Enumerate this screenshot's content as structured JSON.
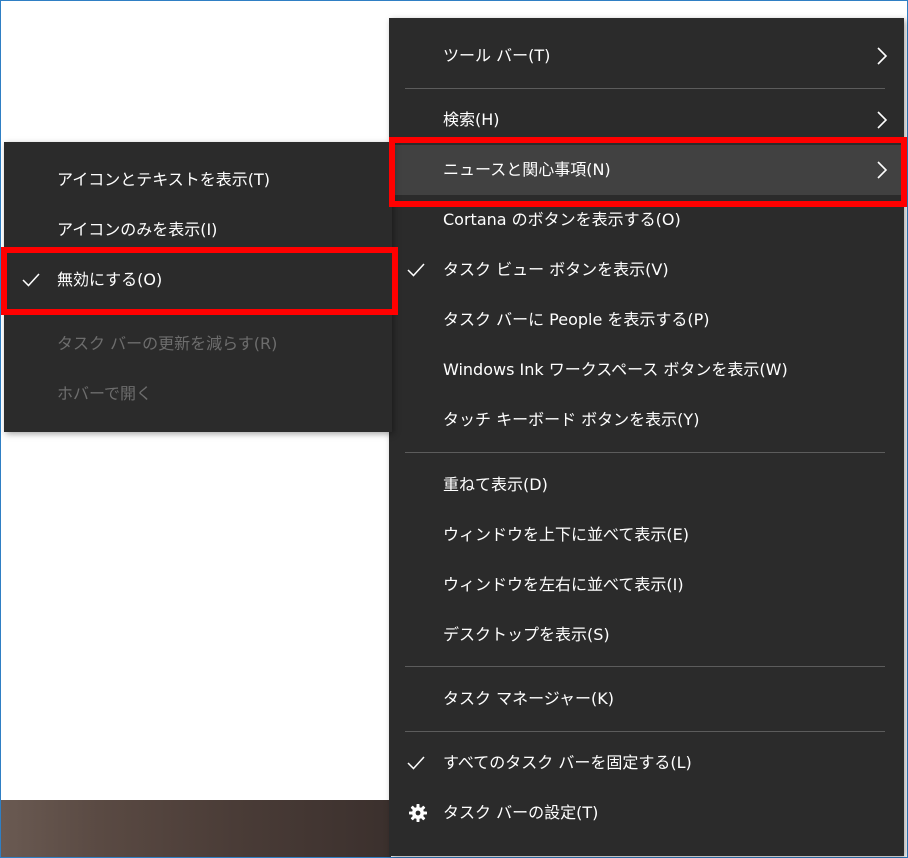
{
  "main_menu": {
    "items": [
      {
        "label": "ツール バー(T)"
      },
      {
        "label": "検索(H)"
      },
      {
        "label": "ニュースと関心事項(N)"
      },
      {
        "label": "Cortana のボタンを表示する(O)"
      },
      {
        "label": "タスク ビュー ボタンを表示(V)"
      },
      {
        "label": "タスク バーに People を表示する(P)"
      },
      {
        "label": "Windows Ink ワークスペース ボタンを表示(W)"
      },
      {
        "label": "タッチ キーボード ボタンを表示(Y)"
      },
      {
        "label": "重ねて表示(D)"
      },
      {
        "label": "ウィンドウを上下に並べて表示(E)"
      },
      {
        "label": "ウィンドウを左右に並べて表示(I)"
      },
      {
        "label": "デスクトップを表示(S)"
      },
      {
        "label": "タスク マネージャー(K)"
      },
      {
        "label": "すべてのタスク バーを固定する(L)"
      },
      {
        "label": "タスク バーの設定(T)"
      }
    ]
  },
  "sub_menu": {
    "items": [
      {
        "label": "アイコンとテキストを表示(T)"
      },
      {
        "label": "アイコンのみを表示(I)"
      },
      {
        "label": "無効にする(O)"
      },
      {
        "label": "タスク バーの更新を減らす(R)"
      },
      {
        "label": "ホバーで開く"
      }
    ]
  },
  "colors": {
    "menu_background": "#2b2b2b",
    "hover_background": "#414141",
    "highlight_border": "#ff0000",
    "disabled_text": "#6d6d6d"
  }
}
